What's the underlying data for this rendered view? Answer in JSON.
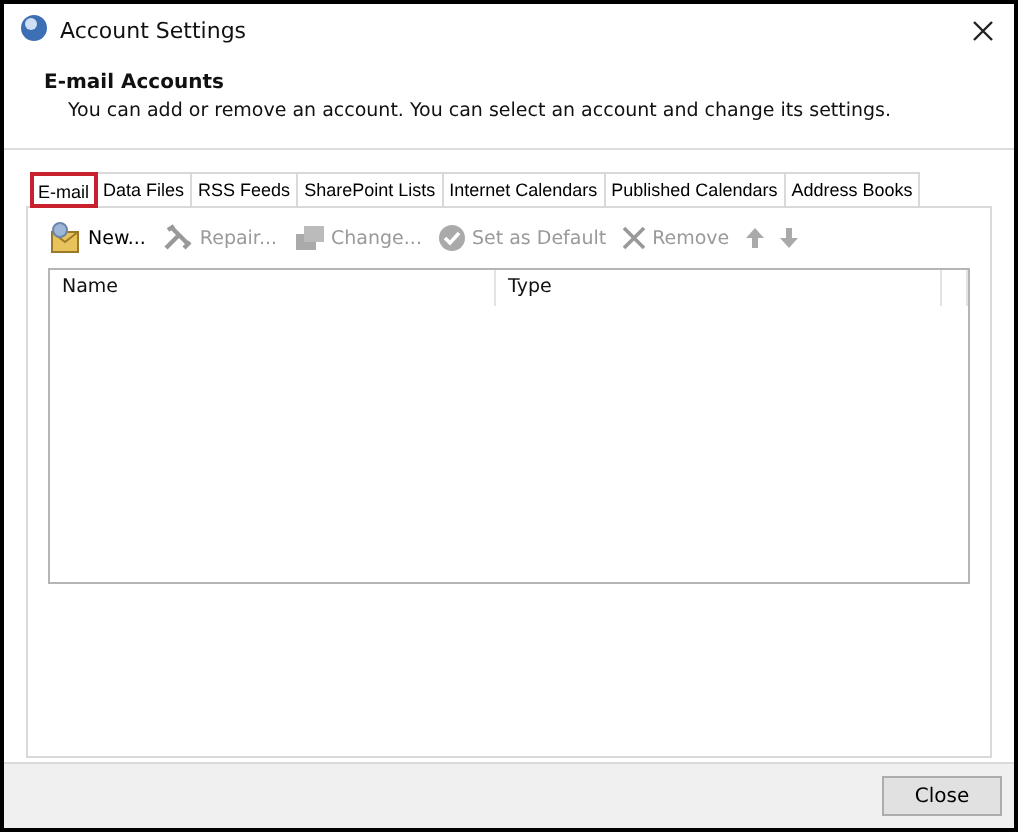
{
  "window": {
    "title": "Account Settings"
  },
  "header": {
    "title": "E-mail Accounts",
    "description": "You can add or remove an account. You can select an account and change its settings."
  },
  "tabs": [
    {
      "label": "E-mail",
      "selected": true,
      "highlighted": true
    },
    {
      "label": "Data Files",
      "selected": false,
      "highlighted": false
    },
    {
      "label": "RSS Feeds",
      "selected": false,
      "highlighted": false
    },
    {
      "label": "SharePoint Lists",
      "selected": false,
      "highlighted": false
    },
    {
      "label": "Internet Calendars",
      "selected": false,
      "highlighted": false
    },
    {
      "label": "Published Calendars",
      "selected": false,
      "highlighted": false
    },
    {
      "label": "Address Books",
      "selected": false,
      "highlighted": false
    }
  ],
  "toolbar": [
    {
      "kind": "new",
      "label": "New...",
      "disabled": false
    },
    {
      "kind": "repair",
      "label": "Repair...",
      "disabled": true
    },
    {
      "kind": "change",
      "label": "Change...",
      "disabled": true
    },
    {
      "kind": "default",
      "label": "Set as Default",
      "disabled": true
    },
    {
      "kind": "remove",
      "label": "Remove",
      "disabled": true
    },
    {
      "kind": "up",
      "disabled": true
    },
    {
      "kind": "down",
      "disabled": true
    }
  ],
  "table": {
    "columns": [
      "Name",
      "Type"
    ]
  },
  "buttons": [
    "Close"
  ]
}
